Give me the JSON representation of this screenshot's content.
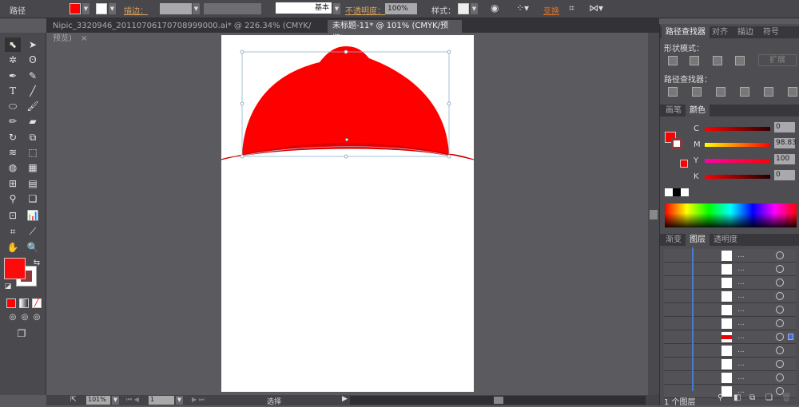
{
  "control_bar": {
    "object_type": "路径",
    "stroke_label": "描边：",
    "stroke_profile": "基本",
    "opacity_label": "不透明度：",
    "opacity_value": "100%",
    "style_label": "样式：",
    "transform_label": "变换",
    "fill_color": "#ff0000"
  },
  "doc_tabs": [
    {
      "label": "Nipic_3320946_20110706170708999000.ai* @ 226.34% (CMYK/预览)",
      "close": "×"
    },
    {
      "label": "未标题-11* @ 101% (CMYK/预览)",
      "close": "×",
      "active": true
    }
  ],
  "status_bar": {
    "zoom": "101%",
    "page": "1",
    "tool": "选择"
  },
  "pathfinder": {
    "tabs": [
      "路径查找器",
      "对齐",
      "描边",
      "符号"
    ],
    "shape_modes_label": "形状模式：",
    "expand_label": "扩展",
    "pathfinders_label": "路径查找器："
  },
  "color_panel": {
    "tabs": [
      "画笔",
      "颜色"
    ],
    "channels": [
      {
        "name": "C",
        "value": "0"
      },
      {
        "name": "M",
        "value": "98.83"
      },
      {
        "name": "Y",
        "value": "100"
      },
      {
        "name": "K",
        "value": "0"
      }
    ]
  },
  "layers_panel": {
    "tabs": [
      "渐变",
      "图层",
      "透明度"
    ],
    "rows": [
      "...",
      "...",
      "...",
      "...",
      "...",
      "...",
      "...",
      "...",
      "...",
      "...",
      "..."
    ],
    "selected_row": 6,
    "footer": "1 个图层"
  },
  "colors": {
    "accent": "#ff0000",
    "selection": "#8ab4d6"
  }
}
